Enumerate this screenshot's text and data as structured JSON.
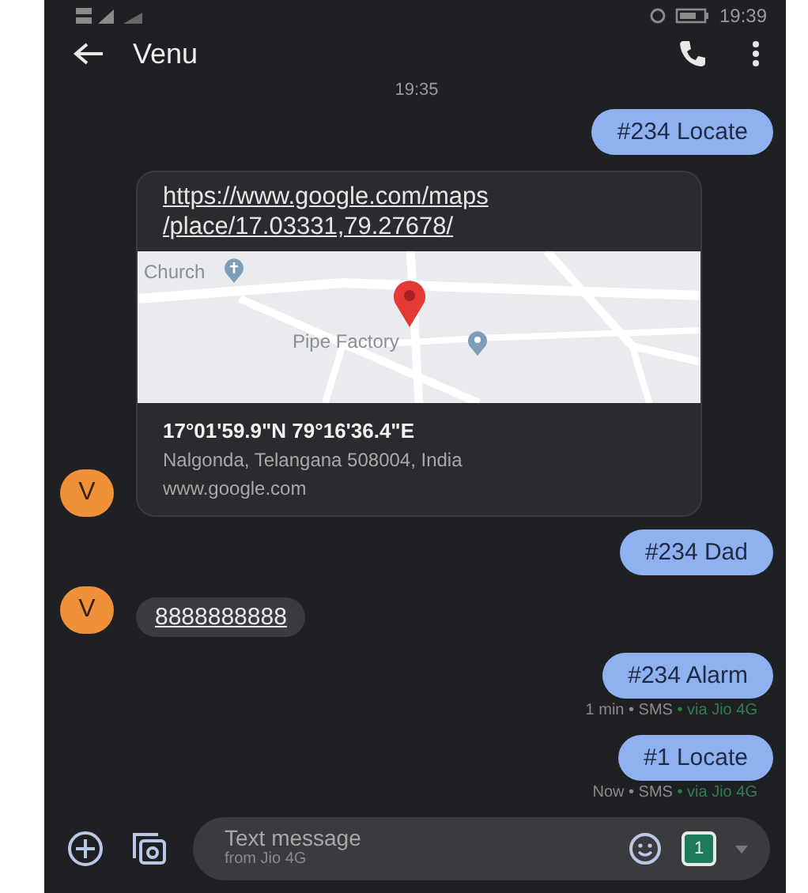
{
  "status_bar": {
    "time": "19:39"
  },
  "header": {
    "title": "Venu"
  },
  "date_divider": "19:35",
  "messages": [
    {
      "kind": "outgoing",
      "text": "#234 Locate"
    },
    {
      "kind": "link_card",
      "avatar": "V",
      "url": "https://www.google.com/maps\n/place/17.03331,79.27678/",
      "map_labels": [
        "Church",
        "Pipe Factory"
      ],
      "title": "17°01'59.9\"N 79°16'36.4\"E",
      "subtitle": "Nalgonda, Telangana 508004, India",
      "domain": "www.google.com"
    },
    {
      "kind": "outgoing",
      "text": "#234 Dad"
    },
    {
      "kind": "incoming",
      "avatar": "V",
      "text": "8888888888"
    },
    {
      "kind": "outgoing",
      "text": "#234 Alarm",
      "meta": "1 min • SMS",
      "network": " • via Jio 4G"
    },
    {
      "kind": "outgoing",
      "text": "#1 Locate",
      "meta": "Now • SMS",
      "network": " • via Jio 4G"
    }
  ],
  "composer": {
    "placeholder": "Text message",
    "sub": "from Jio 4G",
    "sim": "1"
  }
}
